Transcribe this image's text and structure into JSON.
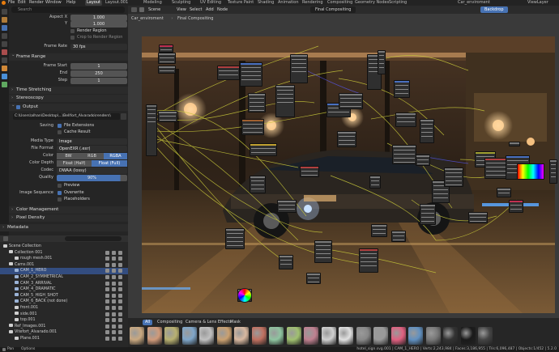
{
  "menu": {
    "items": [
      "File",
      "Edit",
      "Render",
      "Window",
      "Help"
    ]
  },
  "workspaces": {
    "tabs": [
      "Layout",
      "Layout.001",
      "Modeling",
      "Sculpting",
      "UV Editing",
      "Texture Paint",
      "Shading",
      "Animation",
      "Rendering",
      "Compositing",
      "Geometry Nodes",
      "Scripting"
    ],
    "active": "Layout"
  },
  "topright": {
    "scene": "Car_enviroment",
    "backdrop": "Backdrop",
    "viewlayer": "ViewLayer"
  },
  "properties": {
    "search_placeholder": "Search",
    "aspect_x_label": "Aspect X",
    "aspect_x": "1.000",
    "aspect_y_label": "Y",
    "aspect_y": "1.000",
    "render_region": "Render Region",
    "crop_region": "Crop to Render Region",
    "frame_rate_label": "Frame Rate",
    "frame_rate": "30 fps",
    "frame_range_title": "Frame Range",
    "frame_start_label": "Frame Start",
    "frame_start": "1",
    "end_label": "End",
    "end": "250",
    "step_label": "Step",
    "step": "1",
    "time_stretching": "Time Stretching",
    "stereoscopy": "Stereoscopy",
    "output_title": "Output",
    "output_path": "C:\\Users\\alhan\\Desktop\\...\\Bellfort_Alvarado\\renders\\",
    "saving_label": "Saving",
    "file_extensions": "File Extensions",
    "cache_result": "Cache Result",
    "media_type_label": "Media Type",
    "media_type": "Image",
    "file_format_label": "File Format",
    "file_format": "OpenEXR (.exr)",
    "color_label": "Color",
    "color_options": [
      "BW",
      "RGB",
      "RGBA"
    ],
    "color_active": "RGBA",
    "color_depth_label": "Color Depth",
    "depth_options": [
      "Float (Half)",
      "Float (Full)"
    ],
    "depth_active": "Float (Full)",
    "codec_label": "Codec",
    "codec": "DWAA (lossy)",
    "quality_label": "Quality",
    "quality": "90%",
    "preview": "Preview",
    "image_sequence_label": "Image Sequence",
    "overwrite": "Overwrite",
    "placeholders": "Placeholders",
    "color_management": "Color Management",
    "pixel_density": "Pixel Density",
    "metadata": "Metadata"
  },
  "node_editor": {
    "header": [
      "View",
      "Select",
      "Add",
      "Node"
    ],
    "node_tree": "Final Compositing",
    "scene": "Scene",
    "breadcrumb_scene": "Car_enviroment",
    "breadcrumb_tree": "Final Compositing"
  },
  "outliner": {
    "rows": [
      {
        "label": "Scene Collection",
        "indent": 0
      },
      {
        "label": "Collection 001",
        "indent": 1
      },
      {
        "label": "rough mesh.001",
        "indent": 2
      },
      {
        "label": "Cams.001",
        "indent": 1
      },
      {
        "label": "CAM_1_HERO",
        "indent": 2,
        "selected": true
      },
      {
        "label": "CAM_2_SYMMETRICAL",
        "indent": 2
      },
      {
        "label": "CAM_3_ARRIVAL",
        "indent": 2
      },
      {
        "label": "CAM_4_DRAMATIC",
        "indent": 2
      },
      {
        "label": "CAM_5_HIGH_SHOT",
        "indent": 2
      },
      {
        "label": "CAM_6_BACK (not done)",
        "indent": 2
      },
      {
        "label": "front.001",
        "indent": 2
      },
      {
        "label": "side.001",
        "indent": 2
      },
      {
        "label": "top.001",
        "indent": 2
      },
      {
        "label": "Ref_Images.001",
        "indent": 1
      },
      {
        "label": "Vitefort_Alvarado.001",
        "indent": 1
      },
      {
        "label": "Plane.001",
        "indent": 2
      }
    ]
  },
  "asset_bar": {
    "tabs": [
      "All",
      "Compositing",
      "Camera & Lens Effects",
      "Mask"
    ],
    "active": "All"
  },
  "status": {
    "left": [
      "Pan",
      "Options"
    ],
    "right": "hotel_sign.svg.001 | CAM_1_HERO | Verts:2,243,984 | Faces:3,186,955 | Tris:6,096,487 | Objects:1/452 | 5.2.0"
  },
  "colors": {
    "accent": "#4772b3",
    "wire": "#c8c83a",
    "panel": "#252525"
  }
}
